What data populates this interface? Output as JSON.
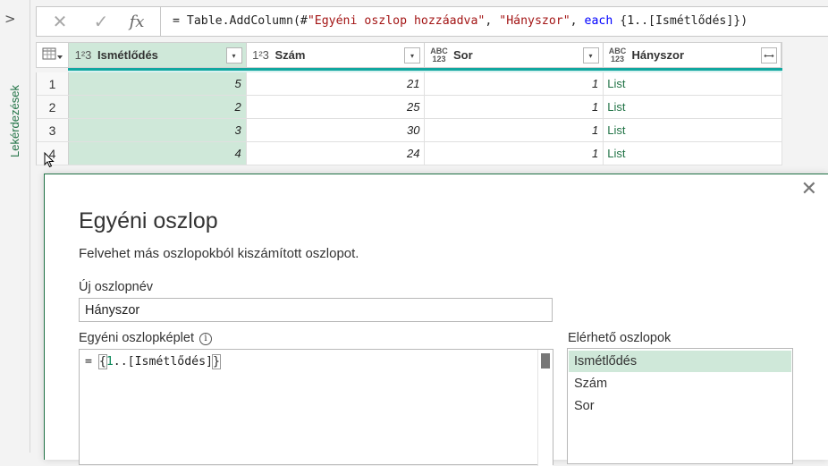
{
  "side_pane": {
    "chevron": ">",
    "label": "Lekérdezések"
  },
  "formula_bar": {
    "cancel_icon": "✕",
    "confirm_icon": "✓",
    "fx_icon": "fx",
    "formula": {
      "prefix": "= Table.AddColumn(#",
      "arg1": "\"Egyéni oszlop hozzáadva\"",
      "sep1": ", ",
      "arg2": "\"Hányszor\"",
      "sep2": ", ",
      "keyword": "each",
      "suffix": " {1..[Ismétlődés]})"
    }
  },
  "grid": {
    "columns": [
      {
        "type": "1²3",
        "name": "Ismétlődés",
        "menu": "▾"
      },
      {
        "type": "1²3",
        "name": "Szám",
        "menu": "▾"
      },
      {
        "type_top": "ABC",
        "type_bottom": "123",
        "name": "Sor",
        "menu": "▾"
      },
      {
        "type_top": "ABC",
        "type_bottom": "123",
        "name": "Hányszor",
        "menu": "⟷"
      }
    ],
    "rows": [
      {
        "num": "1",
        "cells": [
          "5",
          "21",
          "1",
          "List"
        ]
      },
      {
        "num": "2",
        "cells": [
          "2",
          "25",
          "1",
          "List"
        ]
      },
      {
        "num": "3",
        "cells": [
          "3",
          "30",
          "1",
          "List"
        ]
      },
      {
        "num": "4",
        "cells": [
          "4",
          "24",
          "1",
          "List"
        ]
      }
    ]
  },
  "dialog": {
    "close_icon": "✕",
    "title": "Egyéni oszlop",
    "subtitle": "Felvehet más oszlopokból kiszámított oszlopot.",
    "new_column_label": "Új oszlopnév",
    "new_column_value": "Hányszor",
    "formula_label": "Egyéni oszlopképlet",
    "info_icon": "i",
    "formula": {
      "prefix": "= ",
      "open": "{",
      "num": "1",
      "middle": "..[Ismétlődés]",
      "close": "}"
    },
    "available_label": "Elérhető oszlopok",
    "available_columns": [
      "Ismétlődés",
      "Szám",
      "Sor"
    ]
  },
  "colors": {
    "accent": "#217346",
    "header_highlight": "#cfe8d9",
    "teal": "#11a7a0"
  }
}
